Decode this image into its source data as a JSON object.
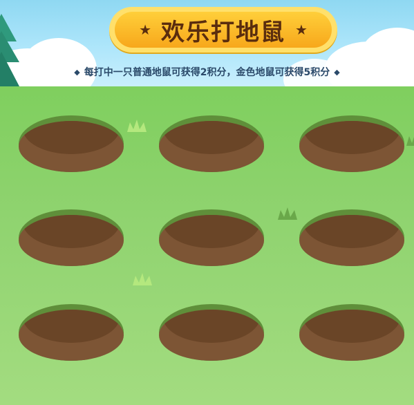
{
  "title": "欢乐打地鼠",
  "subtitle": "每打中一只普通地鼠可获得2积分，金色地鼠可获得5积分",
  "decor": {
    "star_glyph": "★",
    "diamond_glyph": "◆"
  },
  "colors": {
    "sky": "#aee6fb",
    "grass": "#8fd36f",
    "banner_gold": "#f7a71b",
    "title_brown": "#5a2d0e",
    "hole_dirt": "#7d5535"
  },
  "holes": [
    {
      "id": 1
    },
    {
      "id": 2
    },
    {
      "id": 3
    },
    {
      "id": 4
    },
    {
      "id": 5
    },
    {
      "id": 6
    },
    {
      "id": 7
    },
    {
      "id": 8
    },
    {
      "id": 9
    }
  ]
}
